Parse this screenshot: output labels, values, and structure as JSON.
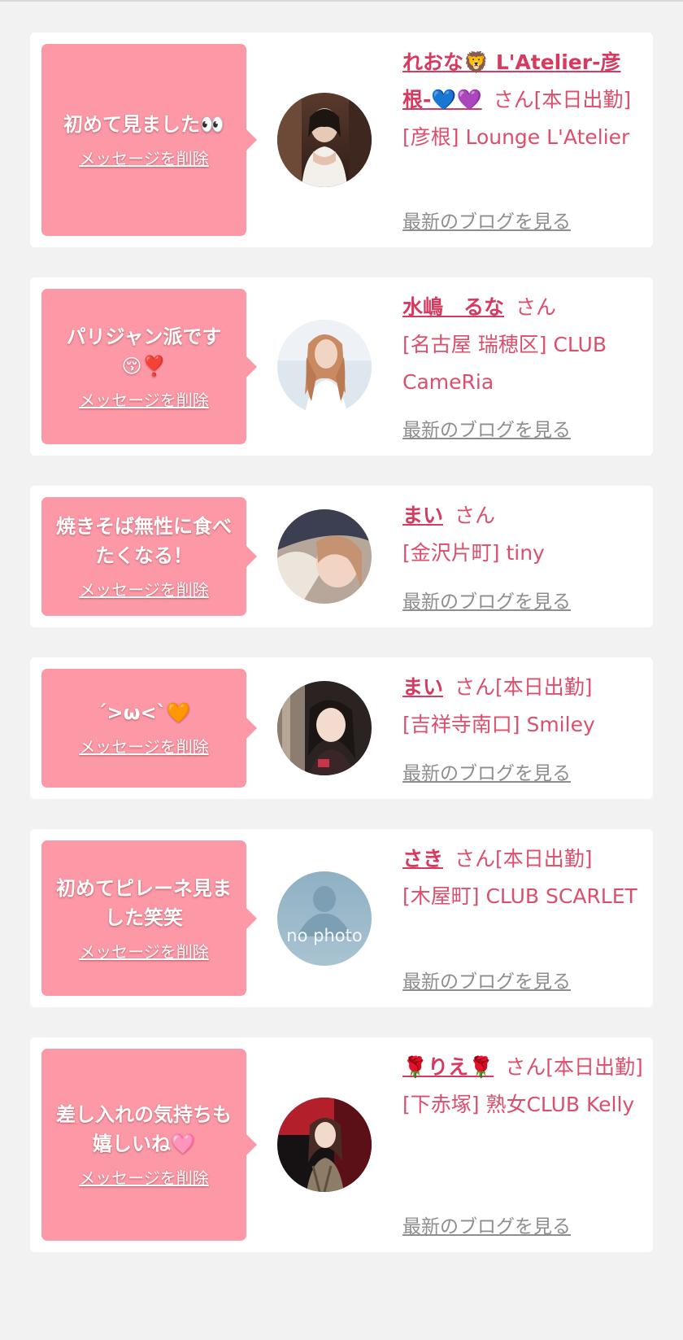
{
  "colors": {
    "page_bg": "#f2f2f2",
    "bubble": "#fd98a6",
    "name": "#d8395f",
    "text": "#db4f6c",
    "link_gray": "#8e8e8e"
  },
  "delete_label": "メッセージを削除",
  "blog_label": "最新のブログを見る",
  "san_label": "さん",
  "cards": [
    {
      "message": "初めて見ました👀",
      "name": "れおな🦁 L'Atelier-彦根-💙💜",
      "status": "[本日出勤]",
      "shop": "[彦根] Lounge L'Atelier",
      "avatar_icon": "photo-woman-white-dress"
    },
    {
      "message": "パリジャン派です😚❣️",
      "name": "水嶋　るな",
      "status": "",
      "shop": "[名古屋 瑞穂区] CLUB CameRia",
      "avatar_icon": "photo-woman-light"
    },
    {
      "message": "焼きそば無性に食べたくなる！",
      "name": "まい",
      "status": "",
      "shop": "[金沢片町] tiny",
      "avatar_icon": "photo-woman-blurred"
    },
    {
      "message": "´>ω<`🧡",
      "name": "まい",
      "status": "[本日出勤]",
      "shop": "[吉祥寺南口] Smiley",
      "avatar_icon": "photo-woman-dark"
    },
    {
      "message": "初めてピレーネ見ました笑笑",
      "name": "さき",
      "status": "[本日出勤]",
      "shop": "[木屋町] CLUB SCARLET",
      "avatar_icon": "no-photo-placeholder",
      "avatar_text": "no photo"
    },
    {
      "message": "差し入れの気持ちも嬉しいね🩷",
      "name": "🌹りえ🌹",
      "status": "[本日出勤]",
      "shop": "[下赤塚] 熟女CLUB Kelly",
      "avatar_icon": "photo-woman-red-room"
    }
  ]
}
